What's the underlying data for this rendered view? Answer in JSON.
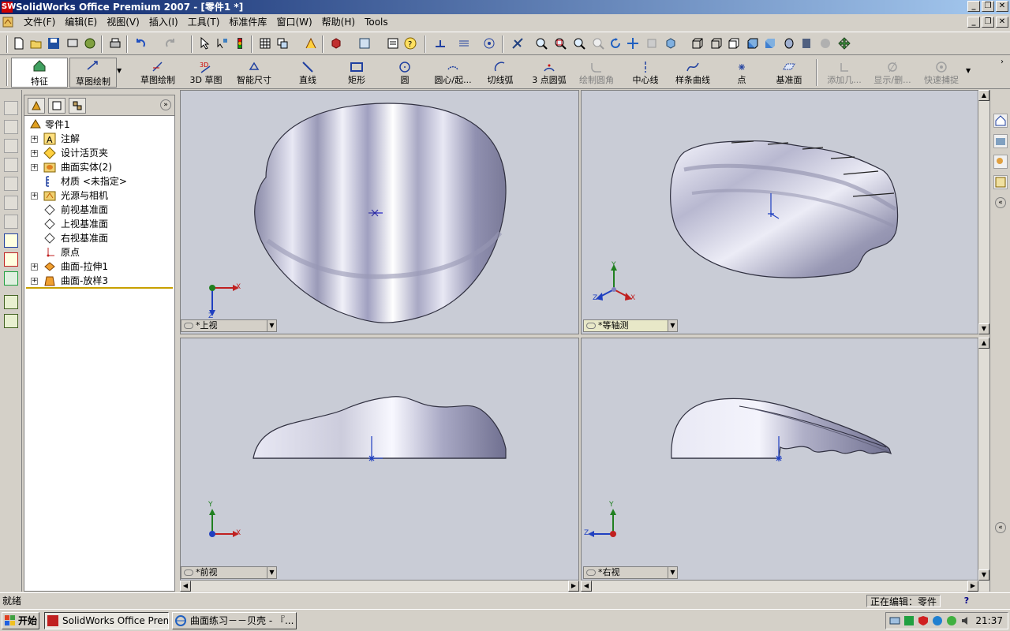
{
  "window": {
    "title": "SolidWorks Office Premium 2007 - [零件1 *]",
    "app_icon": "SW"
  },
  "menu": {
    "items": [
      "文件(F)",
      "编辑(E)",
      "视图(V)",
      "插入(I)",
      "工具(T)",
      "标准件库",
      "窗口(W)",
      "帮助(H)",
      "Tools"
    ]
  },
  "command_manager": {
    "tabs": [
      "特征",
      "草图绘制"
    ],
    "commands": [
      {
        "label": "草图绘制",
        "enabled": true
      },
      {
        "label": "3D 草图",
        "enabled": true
      },
      {
        "label": "智能尺寸",
        "enabled": true
      },
      {
        "label": "直线",
        "enabled": true
      },
      {
        "label": "矩形",
        "enabled": true
      },
      {
        "label": "圆",
        "enabled": true
      },
      {
        "label": "圆心/起...",
        "enabled": true
      },
      {
        "label": "切线弧",
        "enabled": true
      },
      {
        "label": "3 点圆弧",
        "enabled": true
      },
      {
        "label": "绘制圆角",
        "enabled": false
      },
      {
        "label": "中心线",
        "enabled": true
      },
      {
        "label": "样条曲线",
        "enabled": true
      },
      {
        "label": "点",
        "enabled": true
      },
      {
        "label": "基准面",
        "enabled": true
      },
      {
        "label": "添加几...",
        "enabled": false
      },
      {
        "label": "显示/删...",
        "enabled": false
      },
      {
        "label": "快速捕捉",
        "enabled": false
      }
    ]
  },
  "feature_tree": {
    "root": "零件1",
    "items": [
      {
        "label": "注解",
        "expandable": true,
        "icon": "annotation-icon"
      },
      {
        "label": "设计活页夹",
        "expandable": true,
        "icon": "design-binder-icon"
      },
      {
        "label": "曲面实体(2)",
        "expandable": true,
        "icon": "surface-bodies-icon"
      },
      {
        "label": "材质 <未指定>",
        "expandable": false,
        "icon": "material-icon"
      },
      {
        "label": "光源与相机",
        "expandable": true,
        "icon": "lights-camera-icon"
      },
      {
        "label": "前视基准面",
        "expandable": false,
        "icon": "plane-icon"
      },
      {
        "label": "上视基准面",
        "expandable": false,
        "icon": "plane-icon"
      },
      {
        "label": "右视基准面",
        "expandable": false,
        "icon": "plane-icon"
      },
      {
        "label": "原点",
        "expandable": false,
        "icon": "origin-icon"
      },
      {
        "label": "曲面-拉伸1",
        "expandable": true,
        "icon": "surface-extrude-icon"
      },
      {
        "label": "曲面-放样3",
        "expandable": true,
        "icon": "surface-loft-icon"
      }
    ]
  },
  "viewports": {
    "top": {
      "label": "*上视"
    },
    "iso": {
      "label": "*等轴测"
    },
    "front": {
      "label": "*前视"
    },
    "right": {
      "label": "*右视"
    }
  },
  "axes": {
    "x": "X",
    "y": "Y",
    "z": "Z"
  },
  "status": {
    "left": "就绪",
    "right": "正在编辑：零件",
    "help": "?"
  },
  "taskbar": {
    "start": "开始",
    "tasks": [
      "SolidWorks Office Premiu...",
      "曲面练习－－贝壳 - 『..."
    ],
    "clock": "21:37"
  },
  "colors": {
    "viewport_bg": "#c9ccd6",
    "titlebar_start": "#0a246a",
    "titlebar_end": "#a6caf0"
  }
}
